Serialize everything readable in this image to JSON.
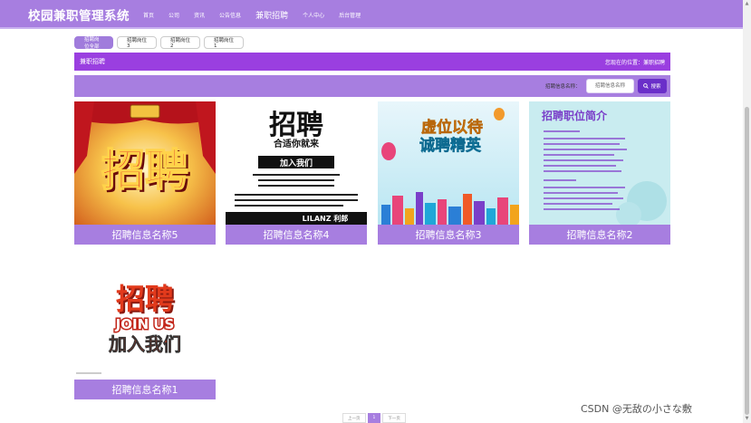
{
  "nav": {
    "brand": "校园兼职管理系统",
    "items": [
      {
        "name": "nav-item-home",
        "label": "首页"
      },
      {
        "name": "nav-item-company",
        "label": "公司"
      },
      {
        "name": "nav-item-news",
        "label": "资讯"
      },
      {
        "name": "nav-item-notice",
        "label": "公告信息"
      },
      {
        "name": "nav-item-jobs",
        "label": "兼职招聘",
        "active": true
      },
      {
        "name": "nav-item-profile",
        "label": "个人中心"
      },
      {
        "name": "nav-item-admin",
        "label": "后台管理"
      }
    ]
  },
  "tabs": [
    {
      "label": "招聘岗位全部",
      "active": true
    },
    {
      "label": "招聘岗位3"
    },
    {
      "label": "招聘岗位2"
    },
    {
      "label": "招聘岗位1"
    }
  ],
  "bar": {
    "title": "兼职招聘",
    "location": "您现在的位置：兼职招聘"
  },
  "search": {
    "label": "招聘信息名称：",
    "placeholder": "招聘信息名称",
    "button": "搜索",
    "icon": "search-icon"
  },
  "cards": [
    {
      "caption": "招聘信息名称5"
    },
    {
      "caption": "招聘信息名称4",
      "poster_lines": [
        "招聘",
        "合适你就来",
        "加入我们",
        "LILANZ 利郎"
      ]
    },
    {
      "caption": "招聘信息名称3",
      "poster_lines": [
        "虚位以待",
        "诚聘精英"
      ]
    },
    {
      "caption": "招聘信息名称2",
      "poster_lines": [
        "招聘职位简介"
      ]
    },
    {
      "caption": "招聘信息名称1",
      "poster_lines": [
        "招聘",
        "JOIN US",
        "加入我们"
      ]
    }
  ],
  "pager": {
    "prev": "上一页",
    "current": "1",
    "next": "下一页"
  },
  "watermark": "CSDN @无敌の小さな敷",
  "colors": {
    "primary": "#a77ee0",
    "bar": "#9a3fe0",
    "button": "#6a2fc9"
  }
}
